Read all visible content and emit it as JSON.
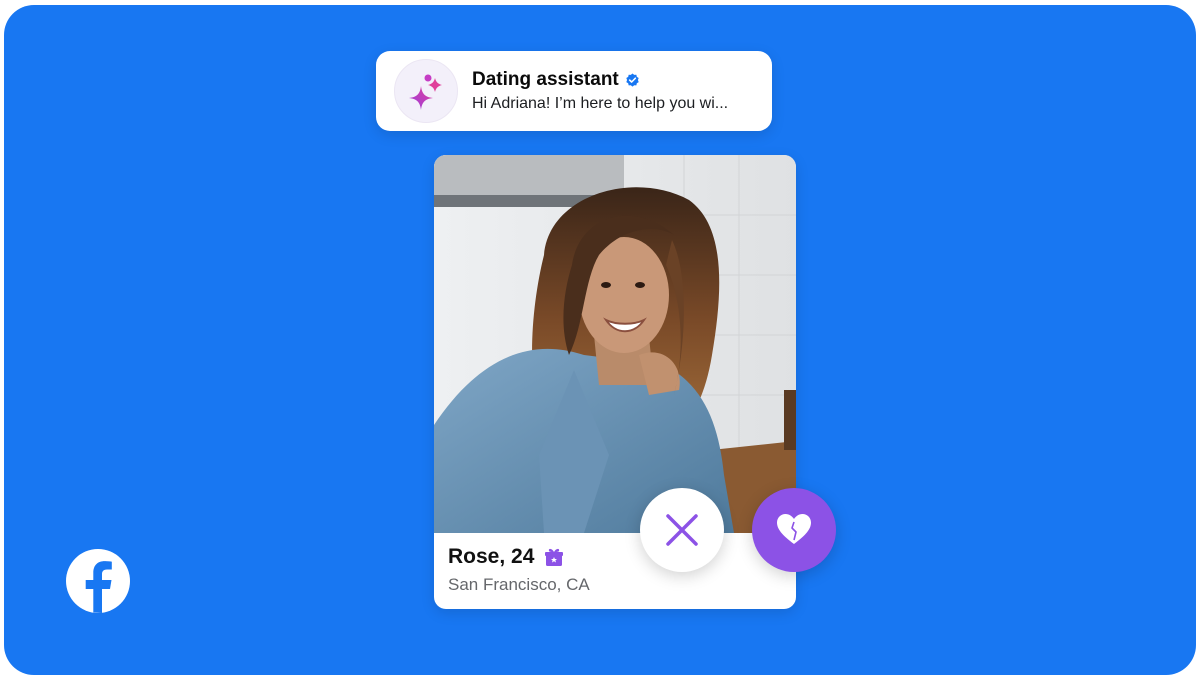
{
  "notification": {
    "title": "Dating assistant",
    "message": "Hi Adriana! I’m here to help you wi...",
    "avatar_icon": "sparkle-icon",
    "verified_icon": "verified-badge-icon",
    "accent_color": "#C53CC5"
  },
  "profile": {
    "name_age": "Rose, 24",
    "location": "San Francisco, CA",
    "badge_icon": "gift-icon",
    "photo_alt": "profile-photo"
  },
  "actions": {
    "pass_icon": "close-icon",
    "like_icon": "heart-icon",
    "like_color": "#8C52E6",
    "pass_color": "#8C52E6"
  },
  "brand": {
    "logo": "facebook-logo",
    "background_color": "#1877F2"
  }
}
